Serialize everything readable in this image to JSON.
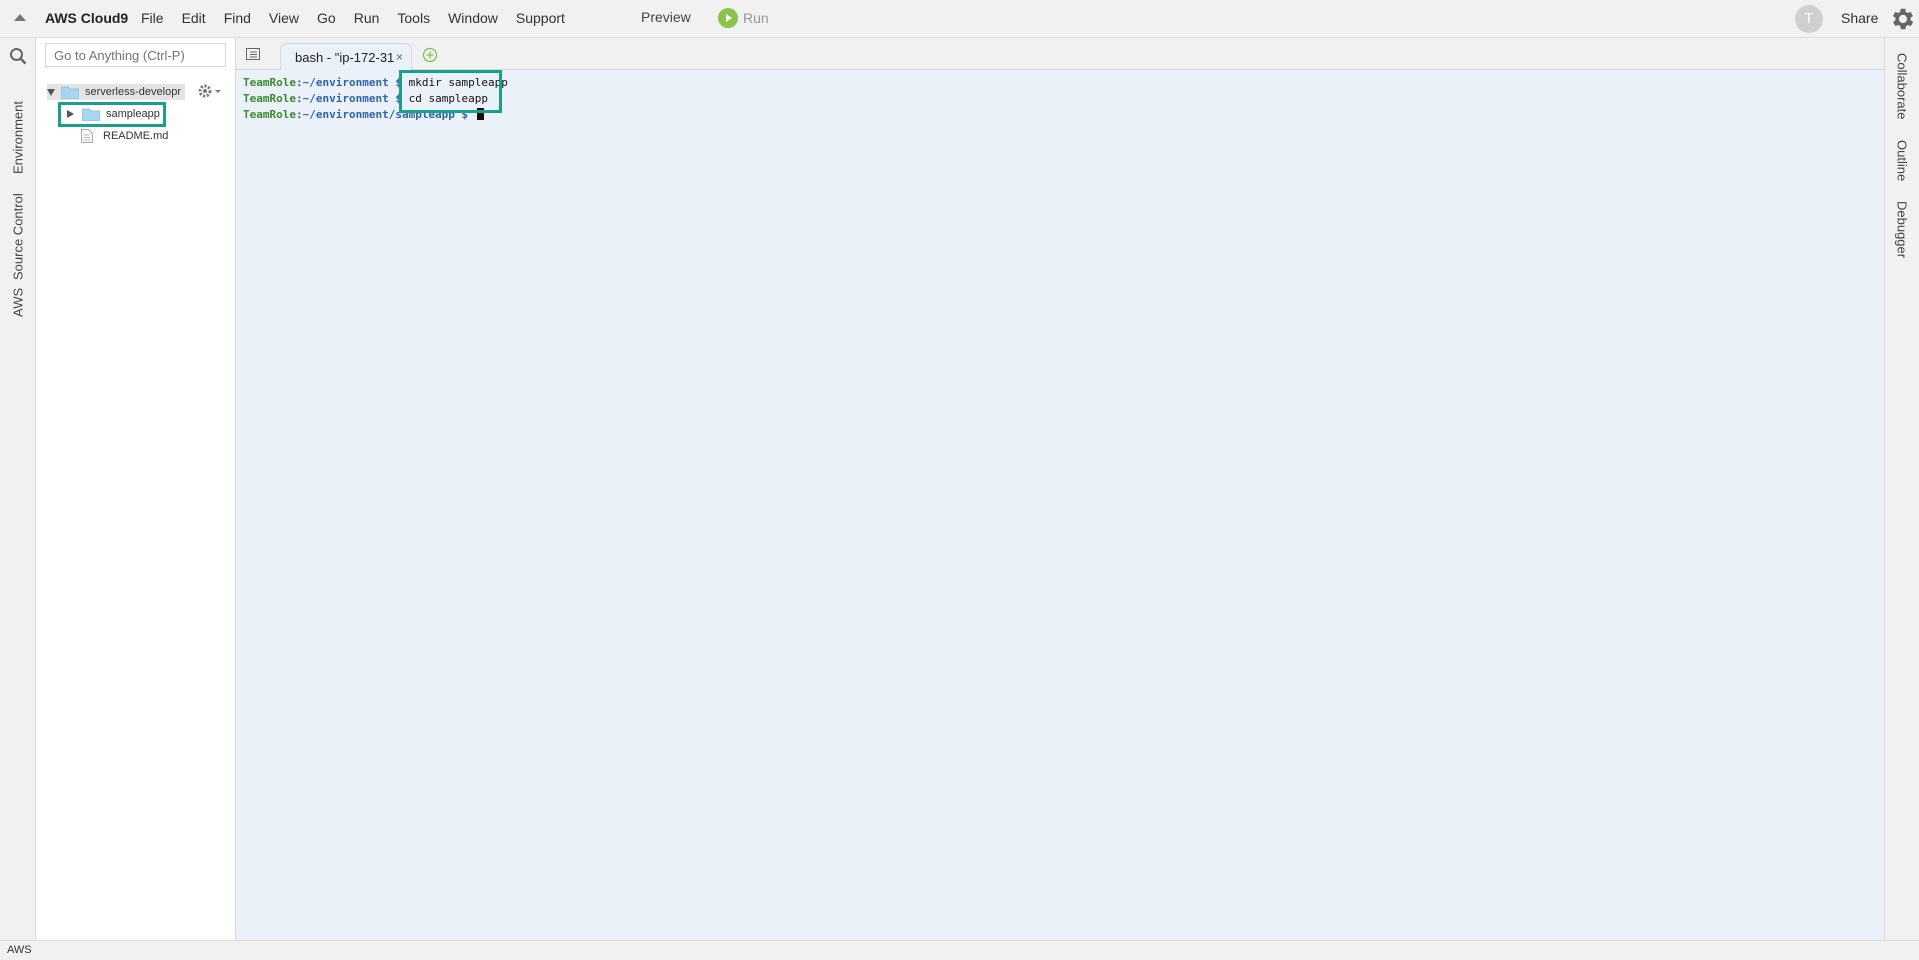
{
  "menubar": {
    "brand": "AWS Cloud9",
    "items": [
      "File",
      "Edit",
      "Find",
      "View",
      "Go",
      "Run",
      "Tools",
      "Window",
      "Support"
    ],
    "preview": "Preview",
    "run": "Run",
    "avatar_letter": "T",
    "share": "Share"
  },
  "left_tabs": [
    "Environment",
    "Source Control",
    "AWS"
  ],
  "search": {
    "placeholder": "Go to Anything (Ctrl-P)"
  },
  "tree": {
    "root": "serverless-developn",
    "items": [
      {
        "name": "sampleapp",
        "type": "folder"
      },
      {
        "name": "README.md",
        "type": "file"
      }
    ]
  },
  "editor_tab": {
    "label": "bash - \"ip-172-31",
    "close": "×"
  },
  "terminal": {
    "lines": [
      {
        "role": "TeamRole",
        "path": ":~/environment",
        "prompt": " $ ",
        "cmd": "mkdir sampleapp"
      },
      {
        "role": "TeamRole",
        "path": ":~/environment",
        "prompt": " $ ",
        "cmd": "cd sampleapp"
      },
      {
        "role": "TeamRole",
        "path": ":~/environment/sampleapp",
        "prompt": " $ ",
        "cmd": ""
      }
    ]
  },
  "right_tabs": [
    "Collaborate",
    "Outline",
    "Debugger"
  ],
  "status": "AWS",
  "colors": {
    "highlight": "#1a9f8a",
    "terminal_bg": "#ebf1f8",
    "run_green": "#8cc34b"
  }
}
